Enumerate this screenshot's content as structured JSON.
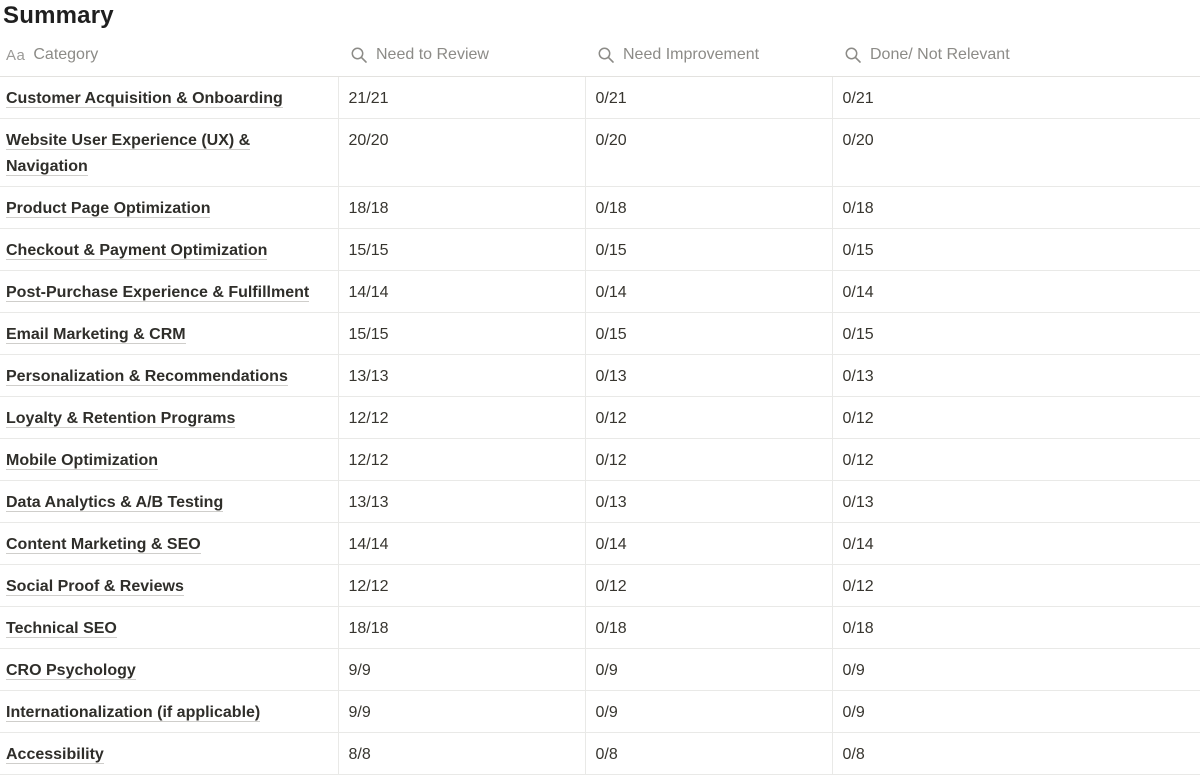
{
  "page_title": "Summary",
  "columns": {
    "category": {
      "icon": "text-property-icon",
      "icon_glyph": "Aa",
      "label": "Category"
    },
    "need_to_review": {
      "icon": "search-icon",
      "label": "Need to Review"
    },
    "need_improvement": {
      "icon": "search-icon",
      "label": "Need Improvement"
    },
    "done_not_relevant": {
      "icon": "search-icon",
      "label": "Done/ Not Relevant"
    }
  },
  "rows": [
    {
      "category": "Customer Acquisition & Onboarding",
      "review": "21/21",
      "improve": "0/21",
      "done": "0/21"
    },
    {
      "category": "Website User Experience (UX) & Navigation",
      "review": "20/20",
      "improve": "0/20",
      "done": "0/20"
    },
    {
      "category": "Product Page Optimization",
      "review": "18/18",
      "improve": "0/18",
      "done": "0/18"
    },
    {
      "category": "Checkout & Payment Optimization",
      "review": "15/15",
      "improve": "0/15",
      "done": "0/15"
    },
    {
      "category": "Post-Purchase Experience & Fulfillment",
      "review": "14/14",
      "improve": "0/14",
      "done": "0/14"
    },
    {
      "category": "Email Marketing & CRM",
      "review": "15/15",
      "improve": "0/15",
      "done": "0/15"
    },
    {
      "category": "Personalization & Recommendations",
      "review": "13/13",
      "improve": "0/13",
      "done": "0/13"
    },
    {
      "category": "Loyalty & Retention Programs",
      "review": "12/12",
      "improve": "0/12",
      "done": "0/12"
    },
    {
      "category": "Mobile Optimization",
      "review": "12/12",
      "improve": "0/12",
      "done": "0/12"
    },
    {
      "category": "Data Analytics & A/B Testing",
      "review": "13/13",
      "improve": "0/13",
      "done": "0/13"
    },
    {
      "category": "Content Marketing & SEO",
      "review": "14/14",
      "improve": "0/14",
      "done": "0/14"
    },
    {
      "category": "Social Proof & Reviews",
      "review": "12/12",
      "improve": "0/12",
      "done": "0/12"
    },
    {
      "category": "Technical SEO",
      "review": "18/18",
      "improve": "0/18",
      "done": "0/18"
    },
    {
      "category": "CRO Psychology",
      "review": "9/9",
      "improve": "0/9",
      "done": "0/9"
    },
    {
      "category": "Internationalization (if applicable)",
      "review": "9/9",
      "improve": "0/9",
      "done": "0/9"
    },
    {
      "category": "Accessibility",
      "review": "8/8",
      "improve": "0/8",
      "done": "0/8"
    }
  ]
}
